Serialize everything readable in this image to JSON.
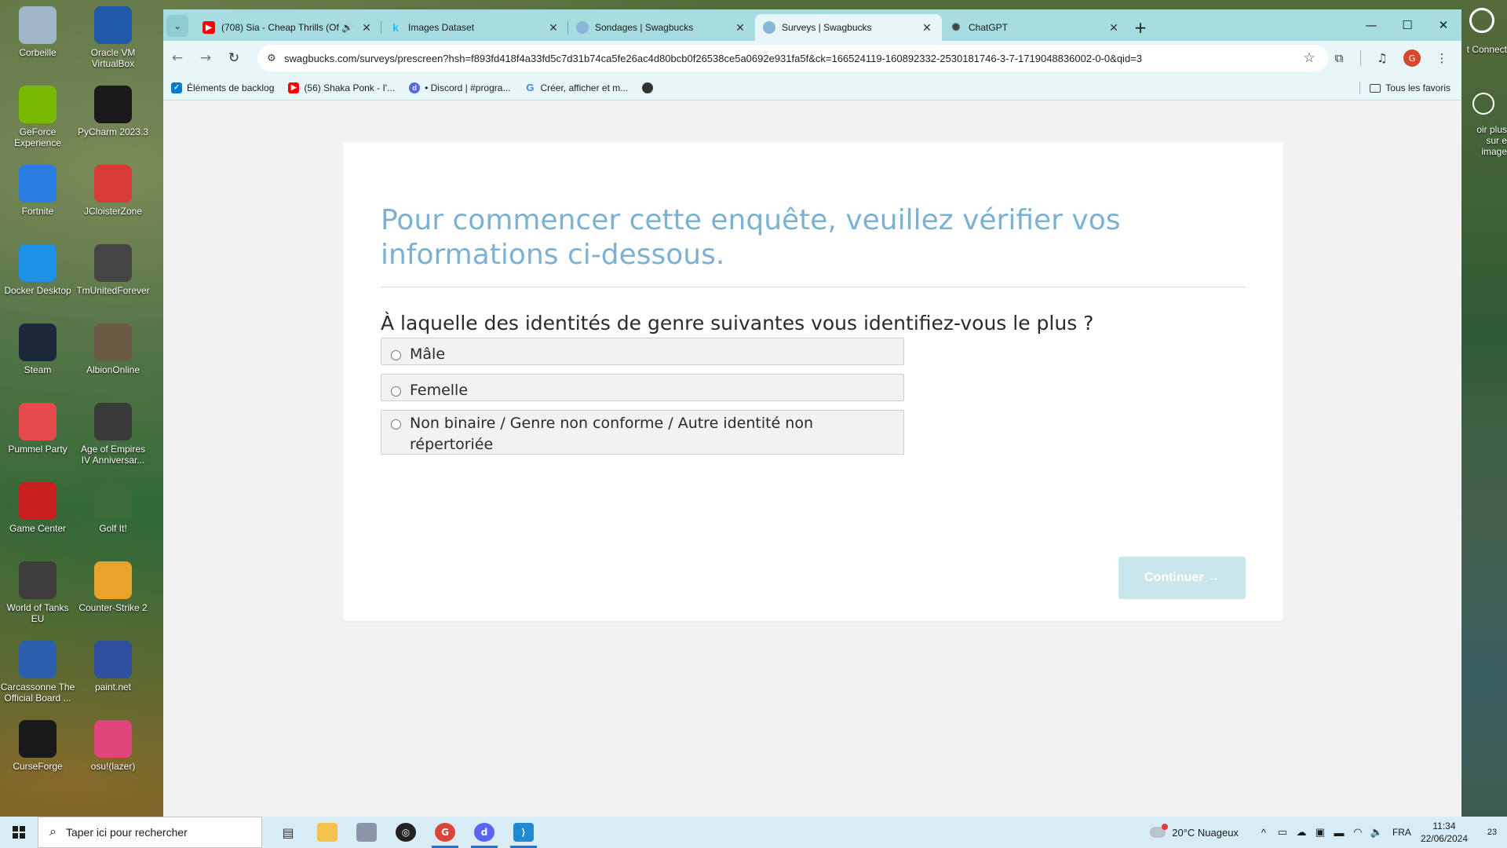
{
  "desktop": {
    "icons": [
      {
        "label": "Corbeille",
        "icon": "recycle-bin-icon",
        "color": "#9fb7c8"
      },
      {
        "label": "Oracle VM VirtualBox",
        "icon": "virtualbox-icon",
        "color": "#1e5aa8"
      },
      {
        "label": "GeForce Experience",
        "icon": "geforce-icon",
        "color": "#76b900"
      },
      {
        "label": "PyCharm 2023.3",
        "icon": "pycharm-icon",
        "color": "#1a1a1a"
      },
      {
        "label": "Fortnite",
        "icon": "fortnite-icon",
        "color": "#2a7de1"
      },
      {
        "label": "JCloisterZone",
        "icon": "meeple-icon",
        "color": "#d83a3a"
      },
      {
        "label": "Docker Desktop",
        "icon": "docker-icon",
        "color": "#1d91e6"
      },
      {
        "label": "TmUnitedForever",
        "icon": "trackmania-icon",
        "color": "#444444"
      },
      {
        "label": "Steam",
        "icon": "steam-icon",
        "color": "#1b2838"
      },
      {
        "label": "AlbionOnline",
        "icon": "albion-icon",
        "color": "#6d5a45"
      },
      {
        "label": "Pummel Party",
        "icon": "dice-icon",
        "color": "#e54b4b"
      },
      {
        "label": "Age of Empires IV Anniversar...",
        "icon": "aoe-icon",
        "color": "#3a3a3a"
      },
      {
        "label": "Game Center",
        "icon": "wargaming-icon",
        "color": "#c81e1e"
      },
      {
        "label": "Golf It!",
        "icon": "golf-icon",
        "color": "#3b6b3b"
      },
      {
        "label": "World of Tanks EU",
        "icon": "wot-icon",
        "color": "#3c3c3c"
      },
      {
        "label": "Counter-Strike 2",
        "icon": "cs2-icon",
        "color": "#e8a32a"
      },
      {
        "label": "Carcassonne The Official Board ...",
        "icon": "carcassonne-icon",
        "color": "#2a5fae"
      },
      {
        "label": "paint.net",
        "icon": "paintnet-icon",
        "color": "#2d4f9e"
      },
      {
        "label": "CurseForge",
        "icon": "curseforge-icon",
        "color": "#1a1a1a"
      },
      {
        "label": "osu!(lazer)",
        "icon": "osu-icon",
        "color": "#e0457b"
      }
    ],
    "right_edge": {
      "label1": "t Connect",
      "label2": "oir plus sur e image"
    }
  },
  "browser": {
    "tabs": [
      {
        "title": "(708) Sia - Cheap Thrills (Of",
        "favicon": "youtube-icon",
        "color": "#ff0000",
        "sound": true
      },
      {
        "title": "Images Dataset",
        "favicon": "kaggle-icon",
        "color": "#20beff"
      },
      {
        "title": "Sondages | Swagbucks",
        "favicon": "swagbucks-icon",
        "color": "#8ab4d8"
      },
      {
        "title": "Surveys | Swagbucks",
        "favicon": "swagbucks-icon",
        "color": "#8ab4d8",
        "active": true
      },
      {
        "title": "ChatGPT",
        "favicon": "chatgpt-icon",
        "color": "#444444"
      }
    ],
    "url": "swagbucks.com/surveys/prescreen?hsh=f893fd418f4a33fd5c7d31b74ca5fe26ac4d80bcb0f26538ce5a0692e931fa5f&ck=166524119-160892332-2530181746-3-7-1719048836002-0-0&qid=3",
    "profile_initial": "G",
    "bookmarks": [
      {
        "label": "Éléments de backlog",
        "icon": "azure-devops-icon",
        "color": "#0078d4"
      },
      {
        "label": "(56) Shaka Ponk - I'...",
        "icon": "youtube-icon",
        "color": "#ff0000"
      },
      {
        "label": "• Discord | #progra...",
        "icon": "discord-icon",
        "color": "#5865f2"
      },
      {
        "label": "Créer, afficher et m...",
        "icon": "google-icon",
        "color": "#4285f4"
      },
      {
        "label": "",
        "icon": "globe-icon",
        "color": "#333333"
      }
    ],
    "all_bookmarks_label": "Tous les favoris"
  },
  "survey": {
    "heading": "Pour commencer cette enquête, veuillez vérifier vos informations ci-dessous.",
    "question": "À laquelle des identités de genre suivantes vous identifiez-vous le plus ?",
    "options": [
      "Mâle",
      "Femelle",
      "Non binaire / Genre non conforme / Autre identité non répertoriée"
    ],
    "continue_label": "Continuer →",
    "accent_color": "#7cb1d1"
  },
  "taskbar": {
    "search_placeholder": "Taper ici pour rechercher",
    "weather": "20°C  Nuageux",
    "language": "FRA",
    "time": "11:34",
    "date": "22/06/2024",
    "notification_count": "23"
  }
}
